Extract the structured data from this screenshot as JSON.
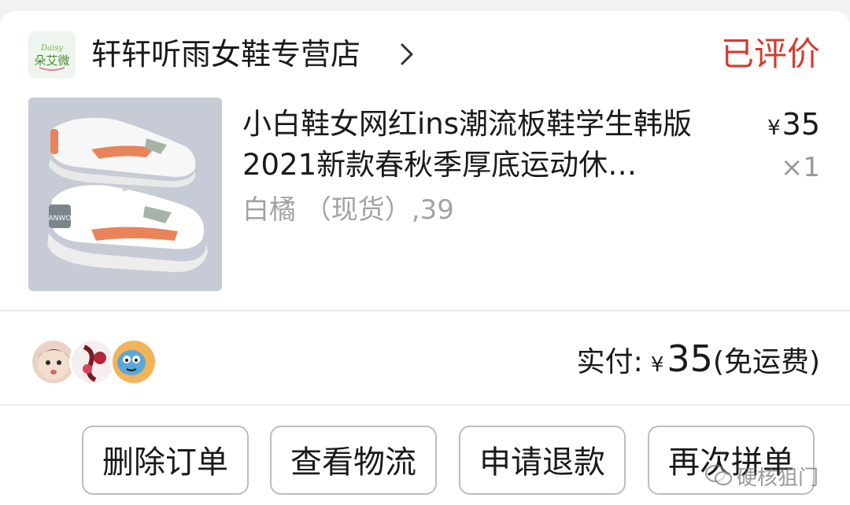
{
  "store": {
    "logo_text": "朵艾微",
    "logo_small": "Daisy",
    "name": "轩轩听雨女鞋专营店",
    "status": "已评价"
  },
  "product": {
    "title": "小白鞋女网红ins潮流板鞋学生韩版2021新款春秋季厚底运动休…",
    "price_symbol": "¥",
    "price": "35",
    "quantity": "×1",
    "spec": "白橘 （现货）,39",
    "image_text": "ANWO"
  },
  "summary": {
    "paid_label": "实付:",
    "currency": "¥",
    "amount": "35",
    "shipping_note": "(免运费)"
  },
  "avatars": [
    "baby-avatar",
    "flower-avatar",
    "cartoon-avatar"
  ],
  "actions": {
    "delete": "删除订单",
    "logistics": "查看物流",
    "refund": "申请退款",
    "rebuy": "再次拼单"
  },
  "watermark": {
    "text": "硬核狙门"
  },
  "colors": {
    "status_red": "#d23c2f",
    "muted_gray": "#a3a3a3"
  }
}
